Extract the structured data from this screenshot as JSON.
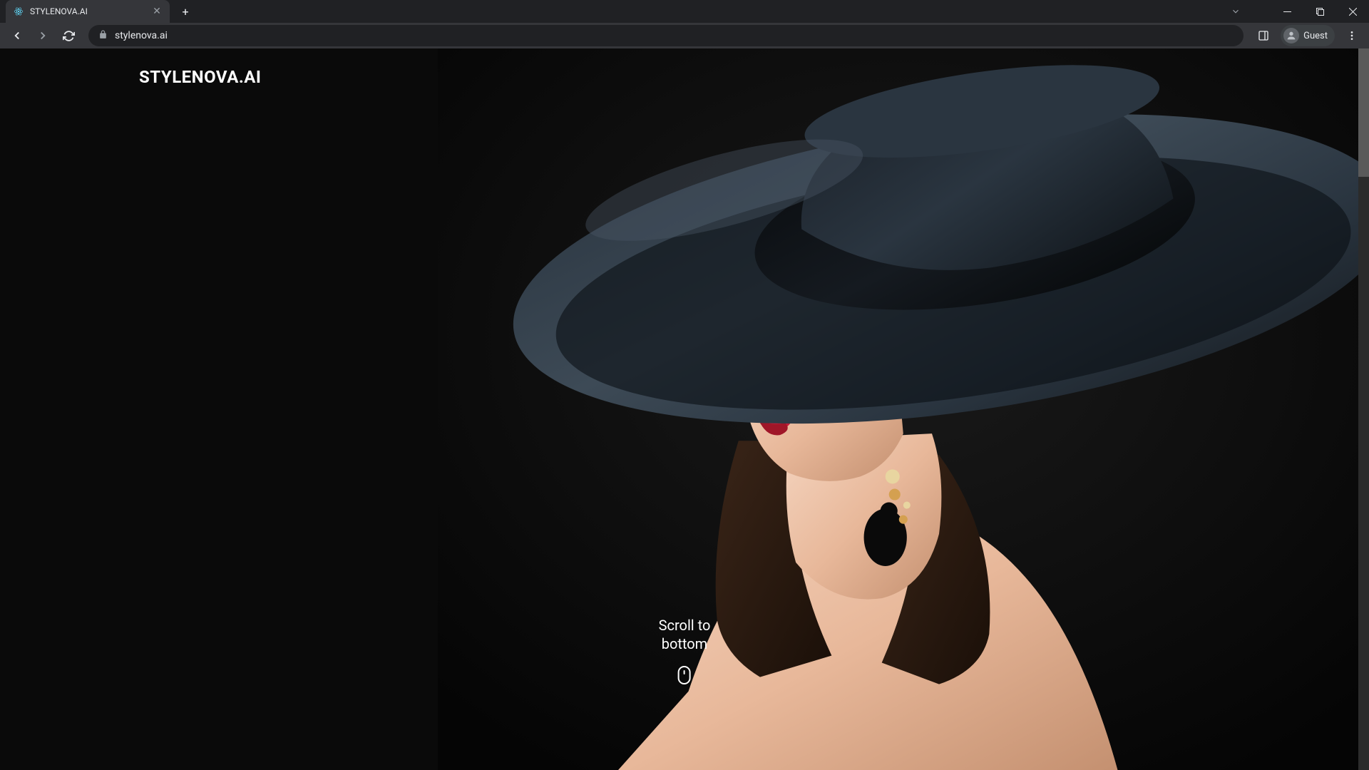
{
  "browser": {
    "tab_title": "STYLENOVA.AI",
    "url": "stylenova.ai",
    "guest_label": "Guest"
  },
  "page": {
    "brand": "STYLENOVA.AI",
    "scroll_text": "Scroll to\nbottom"
  }
}
